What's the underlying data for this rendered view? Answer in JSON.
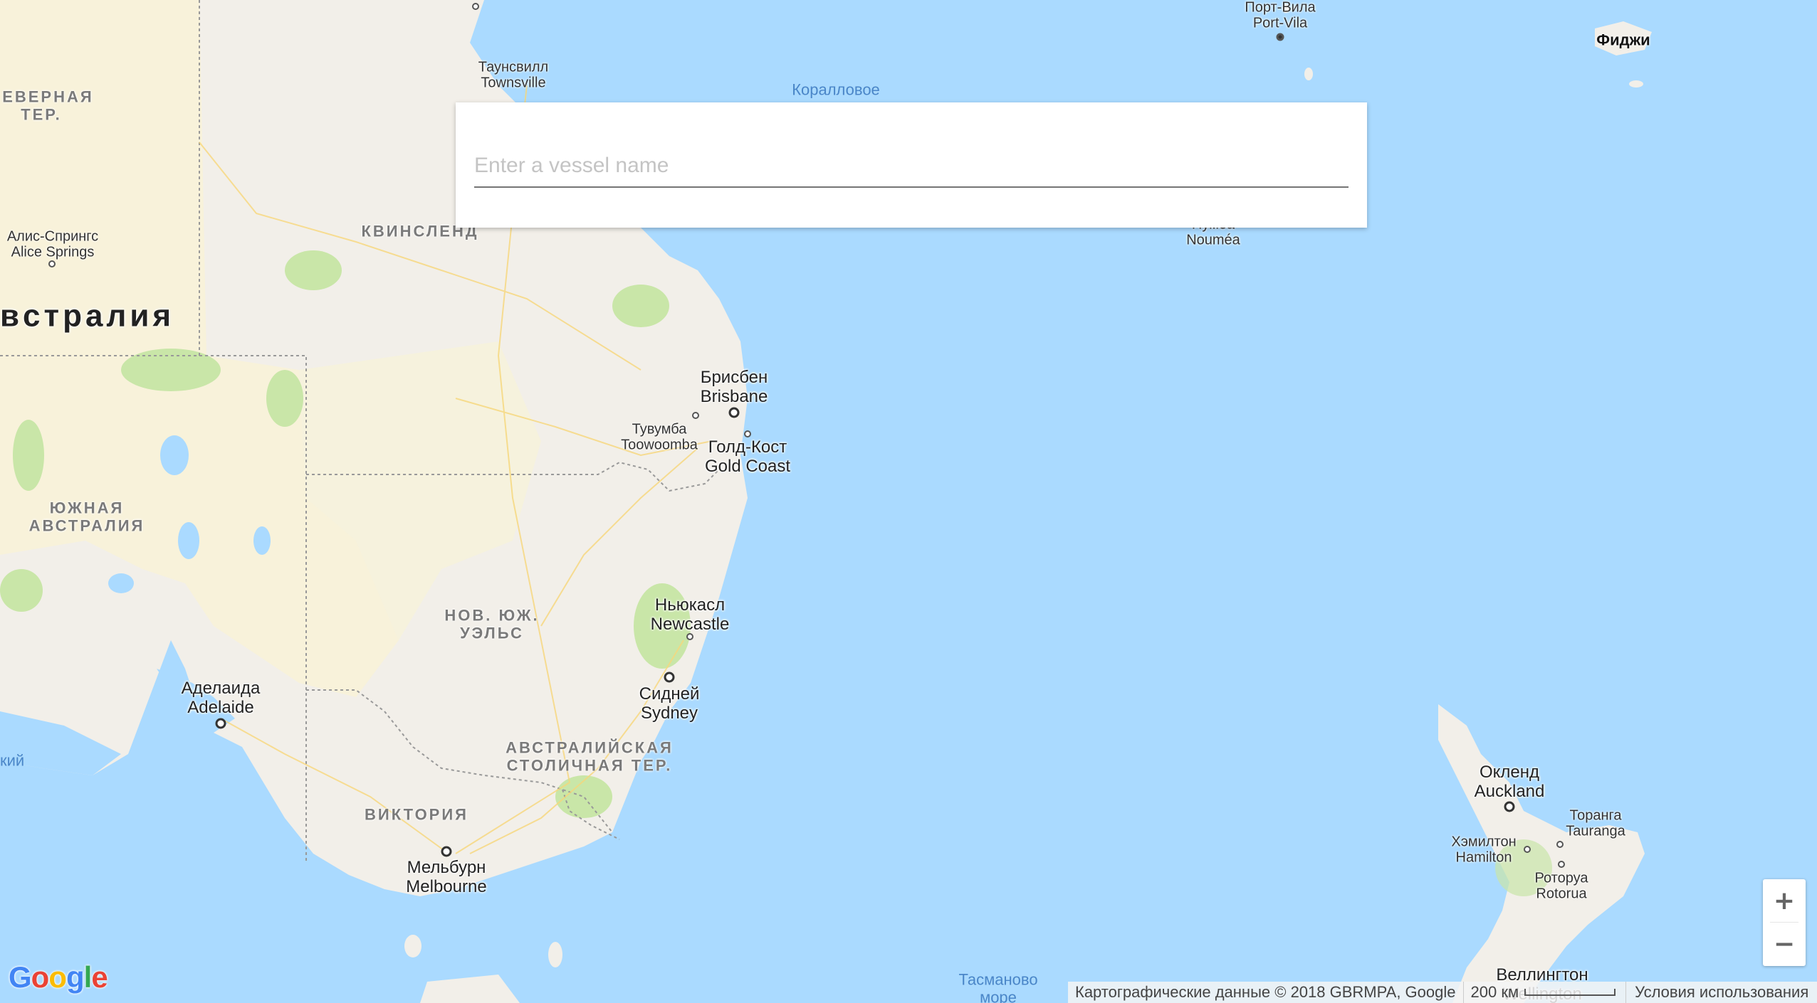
{
  "search": {
    "placeholder": "Enter a vessel name",
    "value": ""
  },
  "map": {
    "country_label": "вcтралия",
    "regions": {
      "northern_territory": "СЕВЕРНАЯ\nТЕР.",
      "queensland": "КВИНСЛЕНД",
      "south_australia": "ЮЖНАЯ\nАВСТРАЛИЯ",
      "nsw": "НОВ. ЮЖ.\nУЭЛЬС",
      "act": "АВСТРАЛИЙСКАЯ\nСТОЛИЧНАЯ ТЕР.",
      "victoria": "ВИКТОРИЯ"
    },
    "cities": {
      "townsville": "Таунсвилл\nTownsville",
      "alice_springs": "Алис-Спрингс\nAlice Springs",
      "brisbane": "Брисбен\nBrisbane",
      "toowoomba": "Тувумба\nToowoomba",
      "gold_coast": "Голд-Кост\nGold Coast",
      "newcastle": "Ньюкасл\nNewcastle",
      "sydney": "Сидней\nSydney",
      "adelaide": "Аделаида\nAdelaide",
      "melbourne": "Мельбурн\nMelbourne",
      "port_vila": "Порт-Вила\nPort-Vila",
      "noumea": "Нумеа\nNouméa",
      "auckland": "Окленд\nAuckland",
      "tauranga": "Торанга\nTauranga",
      "hamilton": "Хэмилтон\nHamilton",
      "rotorua": "Роторуа\nRotorua",
      "wellington": "Веллингтон\nWellington"
    },
    "waters": {
      "coral_sea": "Коралловое",
      "tasman_sea": "Тасманово\nморе",
      "spencer_gulf": "кий"
    },
    "fiji": "Фиджи"
  },
  "controls": {
    "zoom_in": "+",
    "zoom_out": "−"
  },
  "footer": {
    "attribution": "Картографические данные © 2018 GBRMPA, Google",
    "scale": "200 км",
    "terms": "Условия использования"
  },
  "logo": {
    "letters": [
      "G",
      "o",
      "o",
      "g",
      "l",
      "e"
    ],
    "colors": [
      "#4285f4",
      "#ea4335",
      "#fbbc05",
      "#4285f4",
      "#34a853",
      "#ea4335"
    ]
  },
  "colors": {
    "water": "#aadaff",
    "land": "#f2efe9",
    "desert": "#f9f3d6",
    "park": "#c9e6a8"
  }
}
